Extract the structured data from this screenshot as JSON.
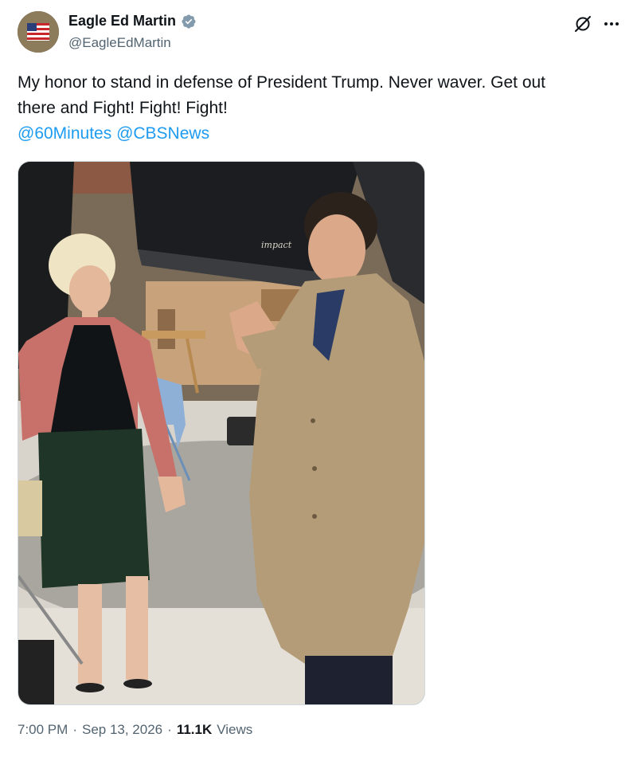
{
  "author": {
    "display_name": "Eagle Ed Martin",
    "handle": "@EagleEdMartin",
    "verified": true,
    "avatar_icon": "flag-avatar"
  },
  "actions": {
    "grok_icon": "grok-icon",
    "more_icon": "more-options-icon"
  },
  "tweet": {
    "line1": "My honor to stand in defense of President Trump. Never waver. Get out",
    "line2": "there and Fight! Fight! Fight!",
    "mentions": [
      "@60Minutes",
      "@CBSNews"
    ]
  },
  "media": {
    "photo_text": "impact"
  },
  "meta": {
    "time": "7:00 PM",
    "date": "Sep 13, 2026",
    "views_count": "11.1K",
    "views_label": "Views",
    "separator": "·"
  },
  "colors": {
    "link": "#1d9bf0",
    "verified": "#829aab",
    "secondary_text": "#536471"
  }
}
